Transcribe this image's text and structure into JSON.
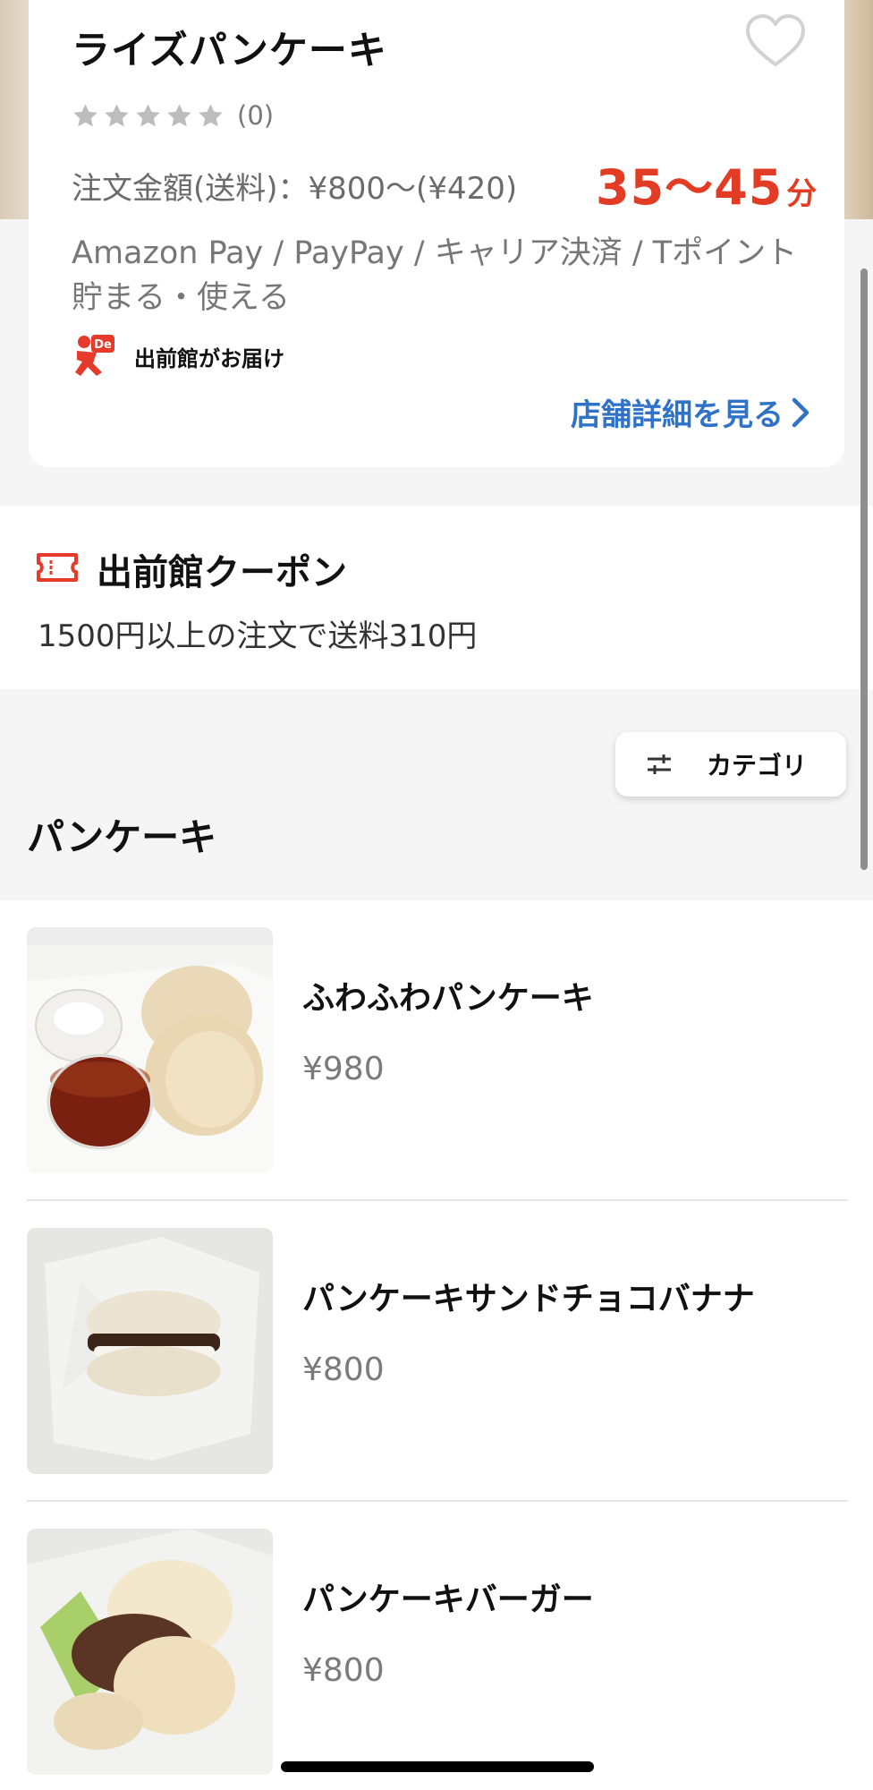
{
  "store": {
    "name": "ライズパンケーキ",
    "rating_count": "(0)",
    "stars": 5,
    "order_info": "注文金額(送料)：¥800〜(¥420)",
    "delivery_time": "35〜45",
    "delivery_unit": "分",
    "payments": "Amazon Pay / PayPay / キャリア決済 / Tポイント貯まる・使える",
    "delivery_by": "出前館がお届け",
    "detail_link": "店舗詳細を見る",
    "demae_logo_text": "De"
  },
  "coupon": {
    "title": "出前館クーポン",
    "description": "1500円以上の注文で送料310円"
  },
  "category": {
    "button_label": "カテゴリ",
    "section_title": "パンケーキ"
  },
  "menu": {
    "items": [
      {
        "name": "ふわふわパンケーキ",
        "price": "¥980"
      },
      {
        "name": "パンケーキサンドチョコバナナ",
        "price": "¥800"
      },
      {
        "name": "パンケーキバーガー",
        "price": "¥800"
      }
    ]
  },
  "colors": {
    "accent_red": "#e33c25",
    "link_blue": "#2f72c6",
    "text_gray": "#777777",
    "background_gray": "#f5f5f5"
  },
  "icons": {
    "favorite": "heart-outline-icon",
    "rating": "star-icon",
    "delivery_logo": "demaekan-logo-icon",
    "detail_arrow": "chevron-right-icon",
    "coupon": "ticket-icon",
    "category": "sliders-icon"
  }
}
